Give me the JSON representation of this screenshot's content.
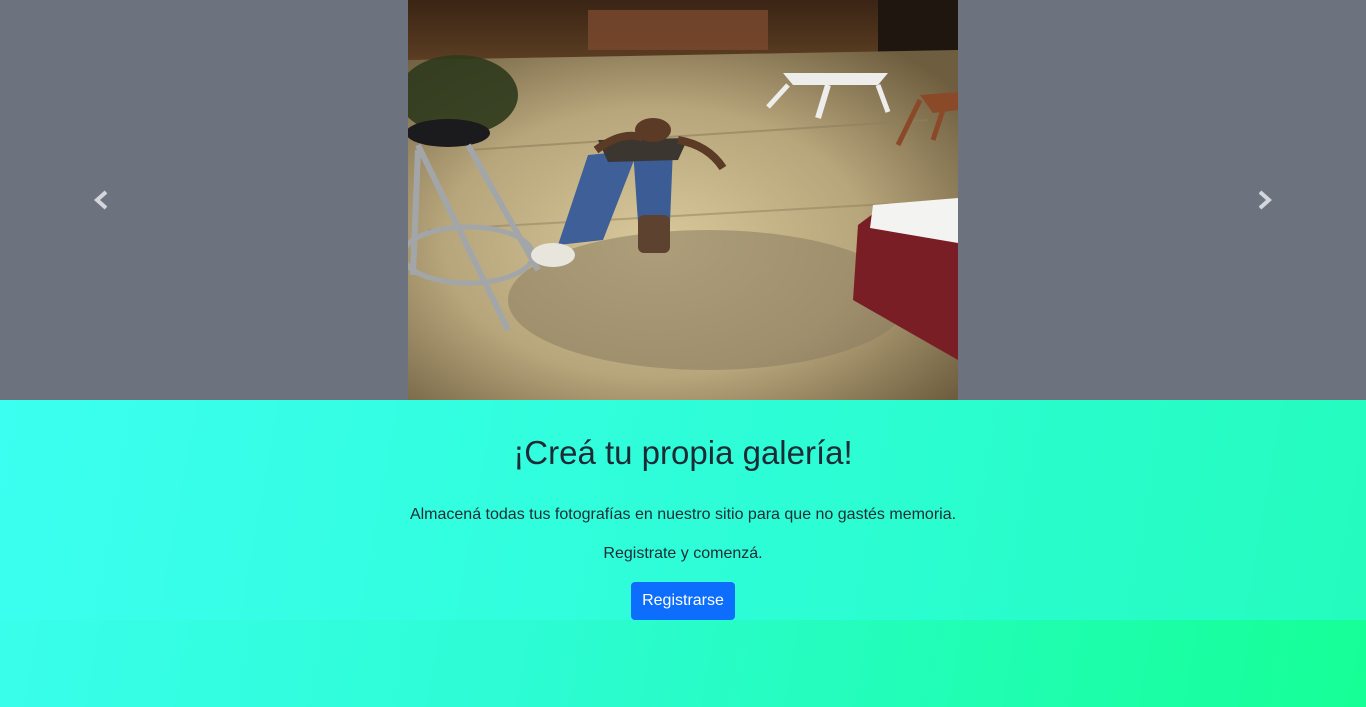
{
  "carousel": {
    "photo_alt": "Persona acostada en el suelo",
    "prev_icon": "chevron-left-icon",
    "next_icon": "chevron-right-icon"
  },
  "cta": {
    "title": "¡Creá tu propia galería!",
    "description": "Almacená todas tus fotografías en nuestro sitio para que no gastés memoria.",
    "subtext": "Registrate y comenzá.",
    "button_label": "Registrarse"
  },
  "colors": {
    "carousel_bg": "#6c737f",
    "button": "#0d6efd",
    "gradient_start": "#3bfff0",
    "gradient_end": "#15ff96"
  }
}
